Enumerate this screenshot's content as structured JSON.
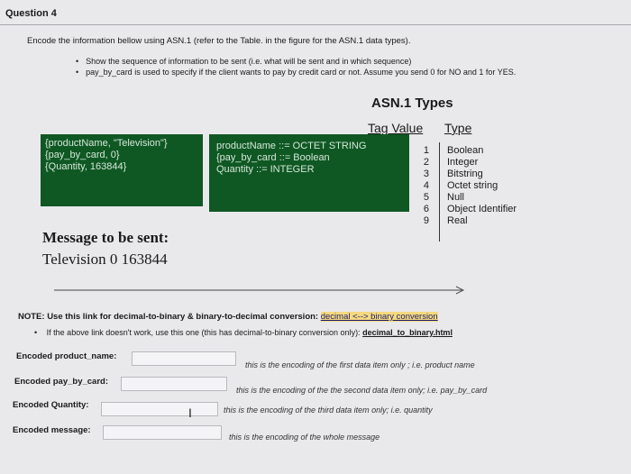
{
  "question": {
    "title": "Question 4"
  },
  "intro": "Encode the information bellow using ASN.1 (refer to the Table. in the figure for the ASN.1 data types).",
  "bullets": [
    "Show the sequence of information to be sent (i.e. what will be sent and in which sequence)",
    "pay_by_card is used to specify if the client wants to pay by credit card or not. Assume you send 0 for NO and 1 for YES."
  ],
  "asn_table": {
    "heading": "ASN.1 Types",
    "tag_header": "Tag Value",
    "type_header": "Type",
    "rows": [
      {
        "tag": "1",
        "type": "Boolean"
      },
      {
        "tag": "2",
        "type": "Integer"
      },
      {
        "tag": "3",
        "type": "Bitstring"
      },
      {
        "tag": "4",
        "type": "Octet string"
      },
      {
        "tag": "5",
        "type": "Null"
      },
      {
        "tag": "6",
        "type": "Object Identifier"
      },
      {
        "tag": "9",
        "type": "Real"
      }
    ]
  },
  "box_values": [
    "{productName, \"Television\"}",
    "{pay_by_card, 0}",
    "{Quantity, 163844}"
  ],
  "box_types": [
    "productName ::= OCTET STRING",
    "{pay_by_card ::= Boolean",
    "Quantity ::= INTEGER"
  ],
  "message": {
    "label": "Message to be sent:",
    "value": "Television 0 163844"
  },
  "note": {
    "text": "NOTE: Use this link for decimal-to-binary & binary-to-decimal conversion:",
    "link": "decimal <--> binary conversion",
    "alt_text": "If the above link doesn't work, use this one (this has decimal-to-binary conversion only):",
    "alt_link": "decimal_to_binary.html"
  },
  "fields": [
    {
      "label": "Encoded product_name:",
      "value": "",
      "hint": "this is the encoding of the  first data item only ; i.e. product name"
    },
    {
      "label": "Encoded pay_by_card:",
      "value": "",
      "hint": "this is the encoding of the the second data item only; i.e. pay_by_card"
    },
    {
      "label": "Encoded Quantity:",
      "value": "",
      "hint": "this is the encoding of the third data item only; i.e. quantity"
    },
    {
      "label": "Encoded message:",
      "value": "",
      "hint": "this is the encoding of the whole message"
    }
  ]
}
